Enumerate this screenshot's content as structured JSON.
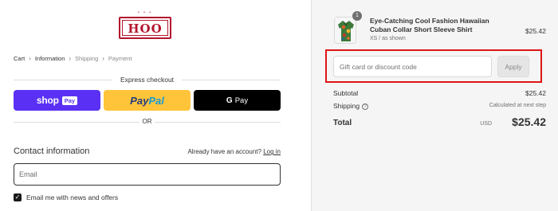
{
  "logo": {
    "text": "HOO",
    "top_text": "• • •"
  },
  "breadcrumb": {
    "items": [
      "Cart",
      "Information",
      "Shipping",
      "Payment"
    ],
    "separator": "›"
  },
  "express": {
    "label": "Express checkout",
    "shop_word": "shop",
    "shop_pay": "Pay",
    "paypal_1": "Pay",
    "paypal_2": "Pal",
    "gpay_g": "G",
    "gpay_word": "Pay",
    "or_label": "OR"
  },
  "contact": {
    "title": "Contact information",
    "account_text": "Already have an account?",
    "login_link": "Log in",
    "email_placeholder": "Email",
    "newsletter_label": "Email me with news and offers",
    "newsletter_checked": true
  },
  "order": {
    "item": {
      "quantity": "1",
      "title": "Eye-Catching Cool Fashion Hawaiian Cuban Collar Short Sleeve Shirt",
      "variant": "XS / as shown",
      "price": "$25.42"
    },
    "discount_placeholder": "Gift card or discount code",
    "apply_label": "Apply",
    "subtotal_label": "Subtotal",
    "subtotal_value": "$25.42",
    "shipping_label": "Shipping",
    "shipping_value": "Calculated at next step",
    "total_label": "Total",
    "total_currency": "USD",
    "total_value": "$25.42"
  },
  "colors": {
    "shop_pay": "#5a31f4",
    "paypal": "#ffc439",
    "gpay": "#000000",
    "highlight": "#e01414",
    "brand": "#b3152e"
  }
}
